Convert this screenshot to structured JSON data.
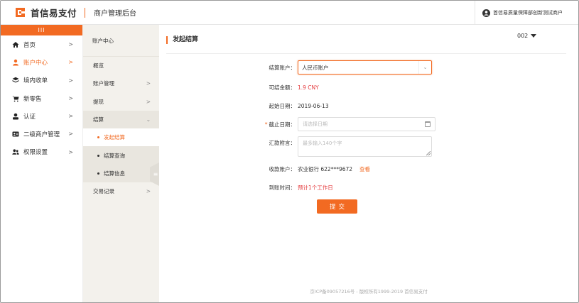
{
  "header": {
    "brand": "首信易支付",
    "subtitle": "商户管理后台",
    "user": "首信易质量保障部创新测试商户"
  },
  "nav": {
    "toggle": "III",
    "items": [
      {
        "label": "首页",
        "icon": "home-icon",
        "active": false
      },
      {
        "label": "账户中心",
        "icon": "person-icon",
        "active": true
      },
      {
        "label": "境内收单",
        "icon": "layers-icon",
        "active": false
      },
      {
        "label": "新零售",
        "icon": "cart-icon",
        "active": false
      },
      {
        "label": "认证",
        "icon": "user-icon",
        "active": false
      },
      {
        "label": "二级商户管理",
        "icon": "id-card-icon",
        "active": false
      },
      {
        "label": "权限设置",
        "icon": "users-icon",
        "active": false
      }
    ]
  },
  "subnav": {
    "title": "账户中心",
    "items": {
      "overview": "概览",
      "account_mgmt": "账户管理",
      "withdraw": "提现",
      "settlement": "结算",
      "start_settlement": "发起结算",
      "settlement_query": "结算查询",
      "settlement_info": "结算信息",
      "transactions": "交易记录"
    }
  },
  "main": {
    "title": "发起结算",
    "version": "002",
    "form": {
      "account_label": "结算账户：",
      "account_value": "人民币账户",
      "balance_label": "可结金额：",
      "balance_value": "1.9 CNY",
      "start_label": "起始日期：",
      "start_value": "2019-06-13",
      "end_required": "*",
      "end_label": "截止日期：",
      "end_placeholder": "请选择日期",
      "remark_label": "汇款附言：",
      "remark_placeholder": "最多输入140个字",
      "payee_label": "收款账户：",
      "payee_value": "农业银行 622***9672",
      "payee_link": "查看",
      "arrival_label": "到账时间：",
      "arrival_value": "预计1个工作日",
      "submit": "提交"
    },
    "footer": "京ICP备09057216号 - 版权所有1999-2019 首信易支付"
  },
  "colors": {
    "accent": "#f26a22",
    "sub_bg": "#f3f1ec",
    "arrival_red": "#e4393c"
  }
}
